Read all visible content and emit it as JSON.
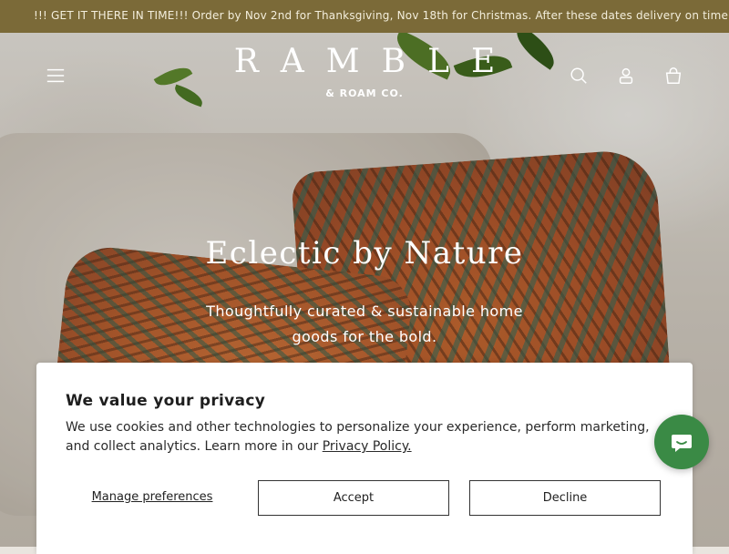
{
  "announcement": {
    "text": "!!! GET IT THERE IN TIME!!! Order by Nov 2nd for Thanksgiving, Nov 18th for Christmas. After these dates delivery on time can't be gua"
  },
  "header": {
    "logo_main": "RAMBLE",
    "logo_sub": "& ROAM CO.",
    "icons": [
      "hamburger-menu-icon",
      "search-icon",
      "account-icon",
      "cart-icon"
    ]
  },
  "hero": {
    "title": "Eclectic by Nature",
    "subtitle": "Thoughtfully curated & sustainable home goods for the bold."
  },
  "cookie_banner": {
    "title": "We value your privacy",
    "body": "We use cookies and other technologies to personalize your experience, perform marketing, and collect analytics. Learn more in our ",
    "policy_link": "Privacy Policy.",
    "manage_label": "Manage preferences",
    "accept_label": "Accept",
    "decline_label": "Decline"
  },
  "chat": {
    "icon": "chat-icon",
    "color": "#3a8a45"
  },
  "colors": {
    "announcement_bg": "#7b6a38",
    "banner_bg": "#ffffff"
  }
}
